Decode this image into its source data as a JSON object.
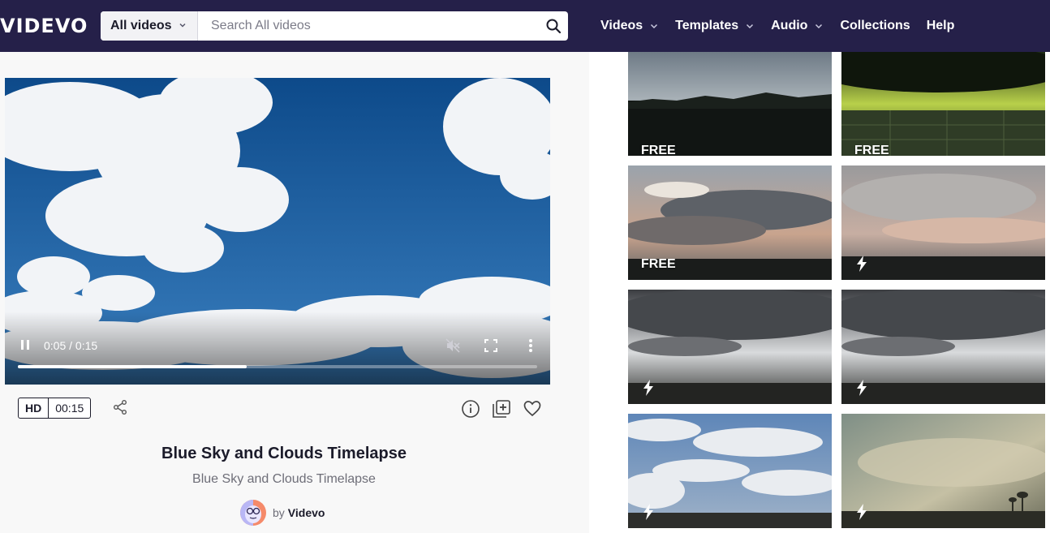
{
  "brand": "VIDEVO",
  "search": {
    "scope": "All videos",
    "placeholder": "Search All videos"
  },
  "nav": [
    {
      "label": "Videos",
      "dropdown": true
    },
    {
      "label": "Templates",
      "dropdown": true
    },
    {
      "label": "Audio",
      "dropdown": true
    },
    {
      "label": "Collections",
      "dropdown": false
    },
    {
      "label": "Help",
      "dropdown": false
    }
  ],
  "player": {
    "time": "0:05 / 0:15",
    "progress": 0.44
  },
  "meta": {
    "quality": "HD",
    "duration": "00:15"
  },
  "video": {
    "title": "Blue Sky and Clouds Timelapse",
    "subtitle": "Blue Sky and Clouds Timelapse",
    "by": "by",
    "author": "Videvo"
  },
  "related": [
    {
      "badge": "FREE",
      "badge_type": "free"
    },
    {
      "badge": "FREE",
      "badge_type": "free"
    },
    {
      "badge": "FREE",
      "badge_type": "free"
    },
    {
      "badge": "",
      "badge_type": "premium"
    },
    {
      "badge": "",
      "badge_type": "premium"
    },
    {
      "badge": "",
      "badge_type": "premium"
    },
    {
      "badge": "",
      "badge_type": "premium"
    },
    {
      "badge": "",
      "badge_type": "premium"
    }
  ],
  "colors": {
    "navbar": "#252049",
    "left_bg": "#f8f8f8",
    "text_dark": "#1b1b2a"
  }
}
